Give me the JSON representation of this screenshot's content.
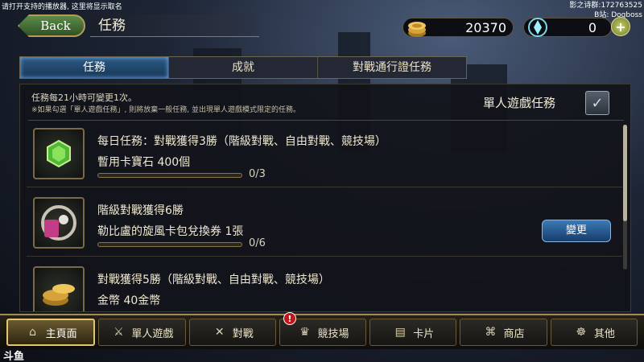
{
  "stream_overlay": {
    "caption": "请打开支持的播放器, 这里将显示取名",
    "group_line1": "影之诗群:172763525",
    "group_line2": "B站: Dogboss"
  },
  "header": {
    "back_label": "Back",
    "title": "任務",
    "gold_amount": "20370",
    "crystal_amount": "0",
    "add_label": "+"
  },
  "tabs": [
    {
      "label": "任務",
      "active": true
    },
    {
      "label": "成就",
      "active": false
    },
    {
      "label": "對戰通行證任務",
      "active": false
    }
  ],
  "panel": {
    "info_line1": "任務每21小時可變更1次。",
    "info_line2": "※如果勾選「單人遊戲任務」, 則將放棄一般任務, 並出現單人遊戲模式限定的任務。",
    "solo_label": "單人遊戲任務",
    "solo_check": "✓"
  },
  "missions": [
    {
      "title": "每日任務：對戰獲得3勝（階級對戰、自由對戰、競技場）",
      "reward": "暫用卡寶石 400個",
      "progress_text": "0/3",
      "progress": 0,
      "icon": "green-gem-icon",
      "change_label": ""
    },
    {
      "title": "階級對戰獲得6勝",
      "reward": "勒比盧的旋風卡包兌換券 1張",
      "progress_text": "0/6",
      "progress": 0,
      "icon": "card-pack-ticket-icon",
      "change_label": "變更"
    },
    {
      "title": "對戰獲得5勝（階級對戰、自由對戰、競技場）",
      "reward": "金幣 40金幣",
      "progress_text": "",
      "progress": 0,
      "icon": "gold-coins-icon",
      "change_label": ""
    }
  ],
  "bottom_nav": [
    {
      "label": "主頁面",
      "icon": "home-icon",
      "active": true
    },
    {
      "label": "單人遊戲",
      "icon": "sword-icon",
      "active": false
    },
    {
      "label": "對戰",
      "icon": "crossed-swords-icon",
      "active": false
    },
    {
      "label": "競技場",
      "icon": "arena-icon",
      "active": false,
      "badge": "!"
    },
    {
      "label": "卡片",
      "icon": "cards-icon",
      "active": false
    },
    {
      "label": "商店",
      "icon": "shop-icon",
      "active": false
    },
    {
      "label": "其他",
      "icon": "other-icon",
      "active": false
    }
  ],
  "watermark": "斗鱼",
  "colors": {
    "tab_active": "#2d5b86",
    "back_green": "#4d7a3a",
    "gold_accent": "#d8b560",
    "badge_red": "#c3161a"
  }
}
